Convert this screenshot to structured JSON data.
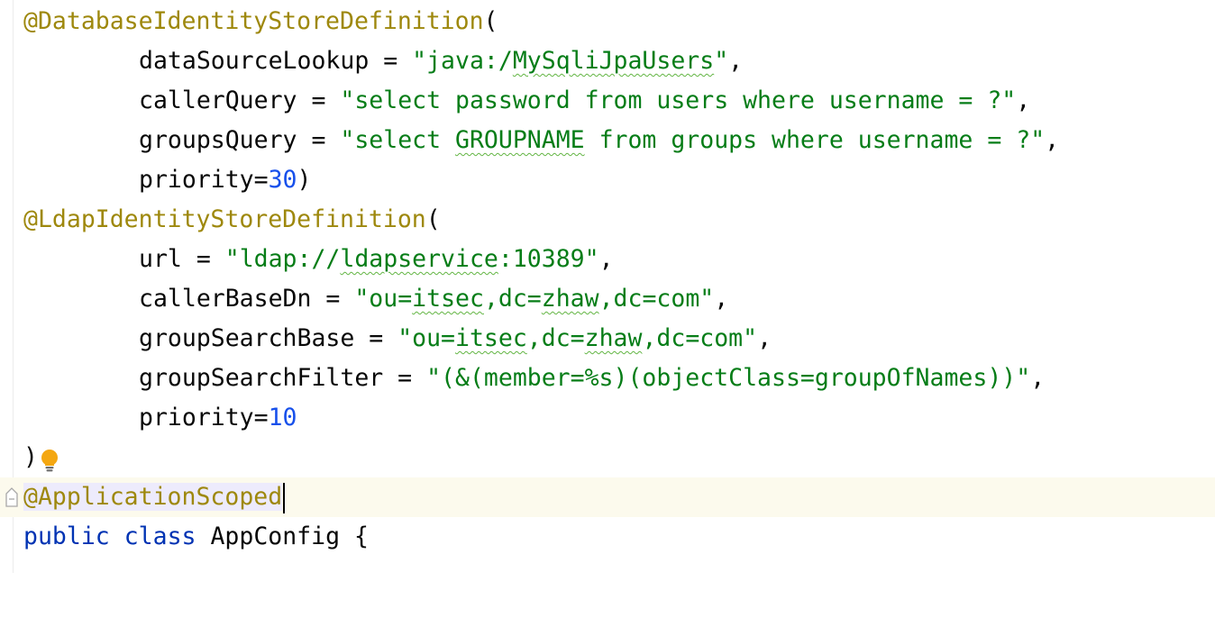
{
  "editor": {
    "db_definition": {
      "annotation": "@DatabaseIdentityStoreDefinition",
      "open_paren": "(",
      "lookup_key": "dataSourceLookup = ",
      "lookup_value_prefix": "\"java:/",
      "lookup_value_typo": "MySqliJpaUsers",
      "lookup_value_suffix": "\"",
      "comma": ",",
      "caller_key": "callerQuery = ",
      "caller_value": "\"select password from users where username = ?\"",
      "groups_key": "groupsQuery = ",
      "groups_value_prefix": "\"select ",
      "groups_value_typo": "GROUPNAME",
      "groups_value_suffix": " from groups where username = ?\"",
      "priority_key": "priority=",
      "priority_value": "30",
      "close_paren": ")"
    },
    "ldap_definition": {
      "annotation": "@LdapIdentityStoreDefinition",
      "open_paren": "(",
      "url_key": "url = ",
      "url_value_prefix": "\"ldap://",
      "url_value_typo": "ldapservice",
      "url_value_suffix": ":10389\"",
      "comma": ",",
      "callerbase_key": "callerBaseDn = ",
      "callerbase_p1": "\"ou=",
      "callerbase_t1": "itsec",
      "callerbase_p2": ",dc=",
      "callerbase_t2": "zhaw",
      "callerbase_p3": ",dc=com\"",
      "groupsearchbase_key": "groupSearchBase = ",
      "groupsearchbase_p1": "\"ou=",
      "groupsearchbase_t1": "itsec",
      "groupsearchbase_p2": ",dc=",
      "groupsearchbase_t2": "zhaw",
      "groupsearchbase_p3": ",dc=com\"",
      "filter_key": "groupSearchFilter = ",
      "filter_value": "\"(&(member=%s)(objectClass=groupOfNames))\"",
      "priority_key": "priority=",
      "priority_value": "10",
      "close_paren": ")"
    },
    "scope_annotation": "@ApplicationScoped",
    "class_decl": {
      "kw_public": "public",
      "kw_class": "class",
      "name": "AppConfig",
      "brace": "{"
    }
  },
  "colors": {
    "annotation": "#9e880d",
    "string": "#067d17",
    "number": "#1750eb",
    "keyword": "#0033b3",
    "current_line_bg": "#fcfaed",
    "intention_bulb": "#f4a712"
  },
  "icons": {
    "intention": "lightbulb-icon",
    "fold": "fold-marker-icon"
  }
}
